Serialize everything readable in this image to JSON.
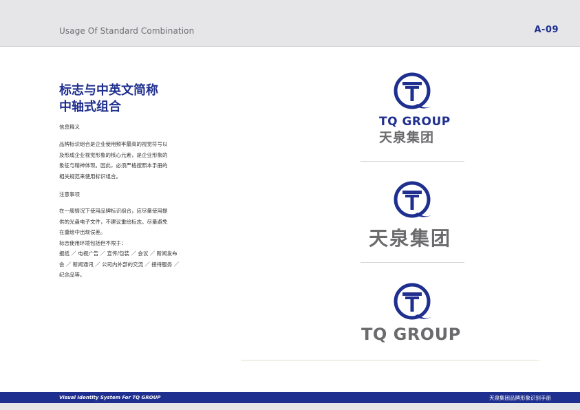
{
  "header": {
    "title": "Usage Of Standard Combination",
    "page_number": "A-09"
  },
  "left": {
    "title_line1": "标志与中英文简称",
    "title_line2": "中轴式组合",
    "section1_label": "信息释义",
    "section1_lines": [
      "品牌标识组合是企业使用频率最高的视觉符号以",
      "及形成企业视觉形象的核心元素，是企业形象的",
      "象征与精神体现。因此，必须严格按照本手册的",
      "相关规范来使用标识组合。"
    ],
    "section2_label": "注意事项",
    "section2_lines": [
      "在一般情况下使用品牌标识组合，应尽量使用提",
      "供的光盘电子文件，不建议重绘标志。尽量避免",
      "在重绘中出现误差。",
      "标志使用环境包括但不限于：",
      "报纸 ／ 电视广告 ／ 宣传/包装 ／ 会议 ／ 新闻发布",
      "会 ／ 新闻通讯 ／ 公司内外部的交流 ／ 接待服务 ／",
      "纪念品等。"
    ]
  },
  "logos": {
    "en_name": "TQ GROUP",
    "cn_name": "天泉集团",
    "emblem_letter": "T",
    "colors": {
      "brand_blue": "#1f2f8f",
      "gray": "#6b6b6e"
    }
  },
  "footer": {
    "left": "Visual Identity System For TQ GROUP",
    "right": "天泉集团品牌形象识别手册"
  }
}
